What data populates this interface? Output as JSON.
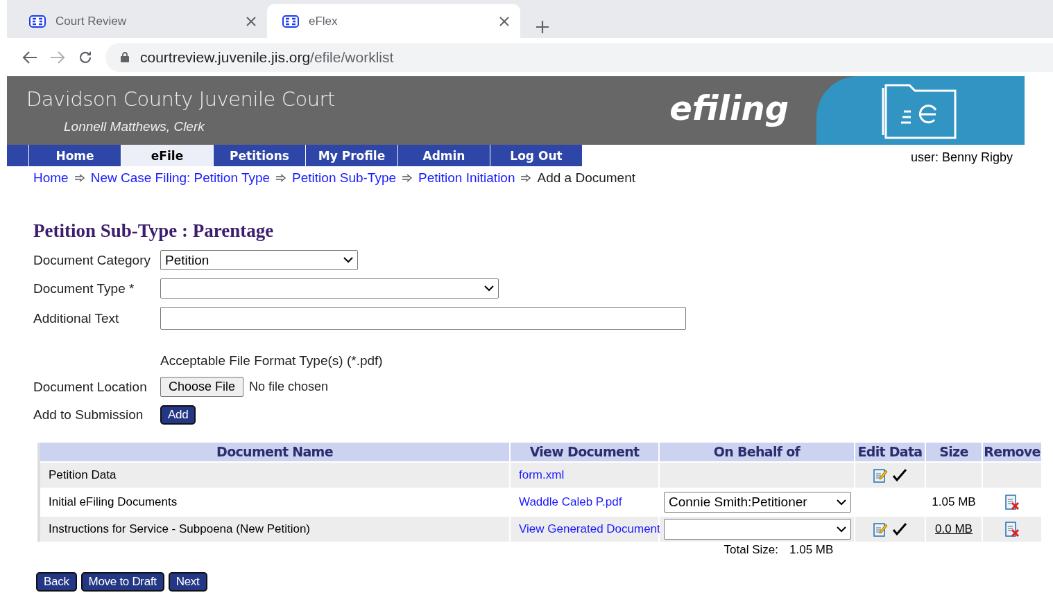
{
  "browser": {
    "tabs": [
      {
        "title": "Court Review",
        "selected": false
      },
      {
        "title": "eFlex",
        "selected": true
      }
    ],
    "url": {
      "host": "courtreview.juvenile.jis.org",
      "path": "/efile/worklist"
    }
  },
  "header": {
    "title": "Davidson County Juvenile Court",
    "subtitle": "Lonnell Matthews, Clerk",
    "brand": "efiling"
  },
  "nav": {
    "items": [
      {
        "label": "Home",
        "selected": false
      },
      {
        "label": "eFile",
        "selected": true
      },
      {
        "label": "Petitions",
        "selected": false
      },
      {
        "label": "My Profile",
        "selected": false
      },
      {
        "label": "Admin",
        "selected": false
      },
      {
        "label": "Log Out",
        "selected": false
      }
    ],
    "user": "user: Benny Rigby"
  },
  "breadcrumb": [
    {
      "label": "Home",
      "kind": "link"
    },
    {
      "label": "New Case Filing: Petition Type",
      "kind": "link"
    },
    {
      "label": "Petition Sub-Type",
      "kind": "link"
    },
    {
      "label": "Petition Initiation",
      "kind": "link"
    },
    {
      "label": "Add a Document",
      "kind": "current"
    }
  ],
  "heading": "Petition Sub-Type : Parentage",
  "form": {
    "category": {
      "label": "Document Category",
      "value": "Petition"
    },
    "type": {
      "label": "Document Type",
      "required": "*"
    },
    "additional": {
      "label": "Additional Text"
    },
    "format_note": "Acceptable File Format Type(s) (*.pdf)",
    "location": {
      "label": "Document Location",
      "button": "Choose File",
      "status": "No file chosen"
    },
    "add": {
      "label": "Add to Submission",
      "button": "Add"
    }
  },
  "table": {
    "columns": [
      "Document Name",
      "View Document",
      "On Behalf of",
      "Edit Data",
      "Size",
      "Remove"
    ],
    "rows": [
      {
        "name": "Petition Data",
        "view": "form.xml",
        "behalf": {
          "kind": "none"
        },
        "edit": true,
        "remove": false
      },
      {
        "name": "Initial eFiling Documents",
        "view": "Waddle Caleb P.pdf",
        "behalf": {
          "kind": "select",
          "value": "Connie Smith:Petitioner"
        },
        "edit": false,
        "size": "1.05 MB",
        "size_link": false,
        "remove": true
      },
      {
        "name": "Instructions for Service - Subpoena (New Petition)",
        "view": "View Generated Document",
        "behalf": {
          "kind": "select"
        },
        "edit": true,
        "size": "0.0 MB",
        "size_link": true,
        "remove": true
      }
    ],
    "total": {
      "label": "Total Size:",
      "value": "1.05 MB"
    }
  },
  "actions": [
    "Back",
    "Move to Draft",
    "Next"
  ]
}
